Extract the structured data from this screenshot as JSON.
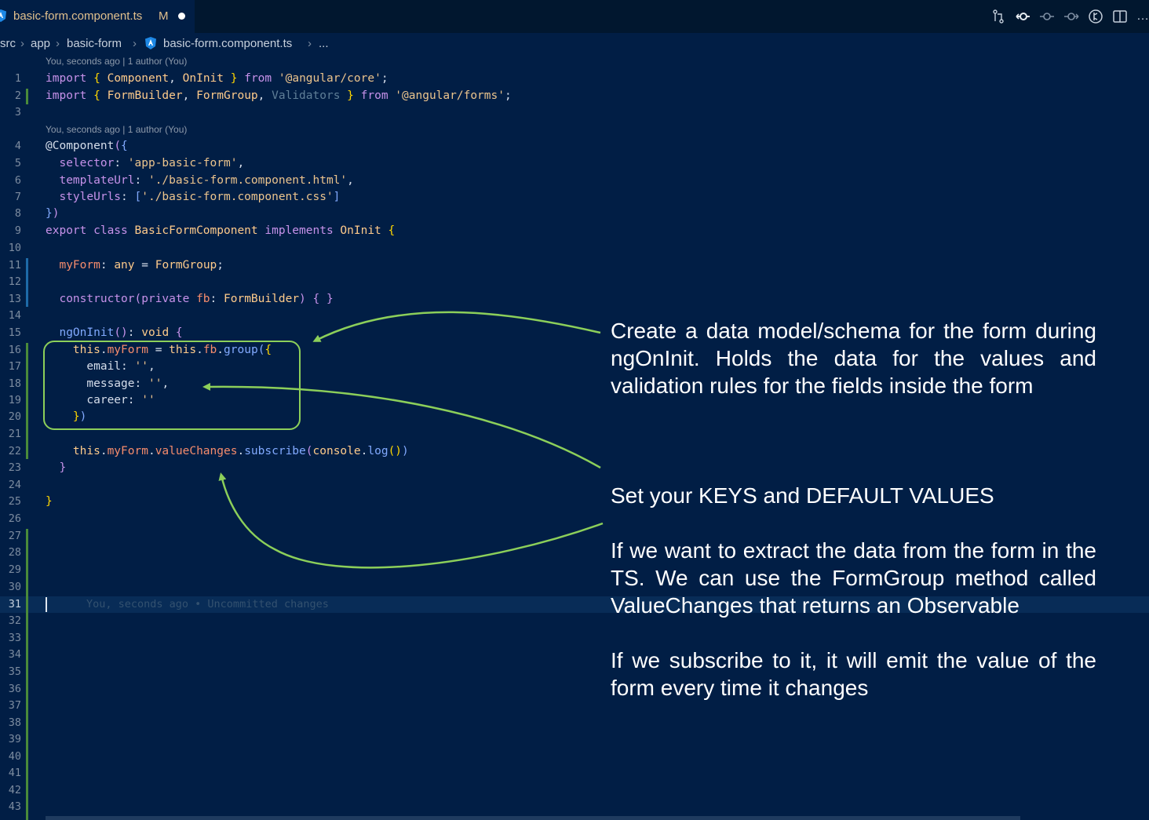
{
  "tab": {
    "filename": "basic-form.component.ts",
    "status": "M"
  },
  "breadcrumb": [
    "src",
    "app",
    "basic-form",
    "basic-form.component.ts",
    "..."
  ],
  "codelens": "You, seconds ago | 1 author (You)",
  "lines": [
    {
      "n": "1"
    },
    {
      "n": "2"
    },
    {
      "n": "3"
    },
    {
      "n": "4"
    },
    {
      "n": "5"
    },
    {
      "n": "6"
    },
    {
      "n": "7"
    },
    {
      "n": "8"
    },
    {
      "n": "9"
    },
    {
      "n": "10"
    },
    {
      "n": "11"
    },
    {
      "n": "12"
    },
    {
      "n": "13"
    },
    {
      "n": "14"
    },
    {
      "n": "15"
    },
    {
      "n": "16"
    },
    {
      "n": "17"
    },
    {
      "n": "18"
    },
    {
      "n": "19"
    },
    {
      "n": "20"
    },
    {
      "n": "21"
    },
    {
      "n": "22"
    },
    {
      "n": "23"
    },
    {
      "n": "24"
    },
    {
      "n": "25"
    },
    {
      "n": "26"
    },
    {
      "n": "27"
    },
    {
      "n": "28"
    },
    {
      "n": "29"
    },
    {
      "n": "30"
    },
    {
      "n": "31"
    },
    {
      "n": "32"
    },
    {
      "n": "33"
    },
    {
      "n": "34"
    },
    {
      "n": "35"
    },
    {
      "n": "36"
    },
    {
      "n": "37"
    },
    {
      "n": "38"
    },
    {
      "n": "39"
    },
    {
      "n": "40"
    },
    {
      "n": "41"
    },
    {
      "n": "42"
    },
    {
      "n": "43"
    }
  ],
  "code": {
    "l1": [
      "import",
      " ",
      "{",
      " Component",
      ",",
      " OnInit",
      " ",
      "}",
      " from ",
      "'@angular/core'",
      ";"
    ],
    "l2": [
      "import",
      " ",
      "{",
      " FormBuilder",
      ",",
      " FormGroup",
      ",",
      " Validators",
      " ",
      "}",
      " from ",
      "'@angular/forms'",
      ";"
    ],
    "l4": [
      "@Component",
      "(",
      "{"
    ],
    "l5": [
      "  selector",
      ": ",
      "'app-basic-form'",
      ","
    ],
    "l6": [
      "  templateUrl",
      ": ",
      "'./basic-form.component.html'",
      ","
    ],
    "l7": [
      "  styleUrls",
      ": ",
      "[",
      "'./basic-form.component.css'",
      "]"
    ],
    "l8": [
      "}",
      ")"
    ],
    "l9": [
      "export class ",
      "BasicFormComponent",
      " implements ",
      "OnInit",
      " ",
      "{"
    ],
    "l11": [
      "  myForm",
      ": ",
      "any",
      " = ",
      "FormGroup",
      ";"
    ],
    "l13": [
      "  constructor",
      "(",
      "private ",
      "fb",
      ": ",
      "FormBuilder",
      ")",
      " ",
      "{ }"
    ],
    "l15": [
      "  ngOnInit",
      "()",
      ": ",
      "void",
      " ",
      "{"
    ],
    "l16": [
      "    this",
      ".",
      "myForm",
      " = ",
      "this",
      ".",
      "fb",
      ".",
      "group",
      "(",
      "{"
    ],
    "l17": [
      "      email",
      ": ",
      "''",
      ","
    ],
    "l18": [
      "      message",
      ": ",
      "''",
      ","
    ],
    "l19": [
      "      career",
      ": ",
      "''"
    ],
    "l20": [
      "    }",
      ")"
    ],
    "l22": [
      "    this",
      ".",
      "myForm",
      ".",
      "valueChanges",
      ".",
      "subscribe",
      "(",
      "console",
      ".",
      "log",
      "()",
      ")"
    ],
    "l23": [
      "  }"
    ],
    "l25": [
      "}"
    ]
  },
  "blame_inline": "You, seconds ago • Uncommitted changes",
  "annotations": {
    "a1": "Create a data model/schema for the form during ngOnInit. Holds the data for the values and validation rules for the fields inside the form",
    "a2": "Set your KEYS and DEFAULT VALUES",
    "a3": "If we want to extract the data from the form in the TS. We can use the FormGroup method called ValueChanges that returns an Observable",
    "a4": "If we subscribe to it, it will emit the value of the form every time it changes"
  },
  "colors": {
    "background": "#011e45",
    "annotation_green": "#8ccf5a",
    "modified_gutter": "#4a8a3a",
    "added_gutter": "#1e6aa8"
  }
}
